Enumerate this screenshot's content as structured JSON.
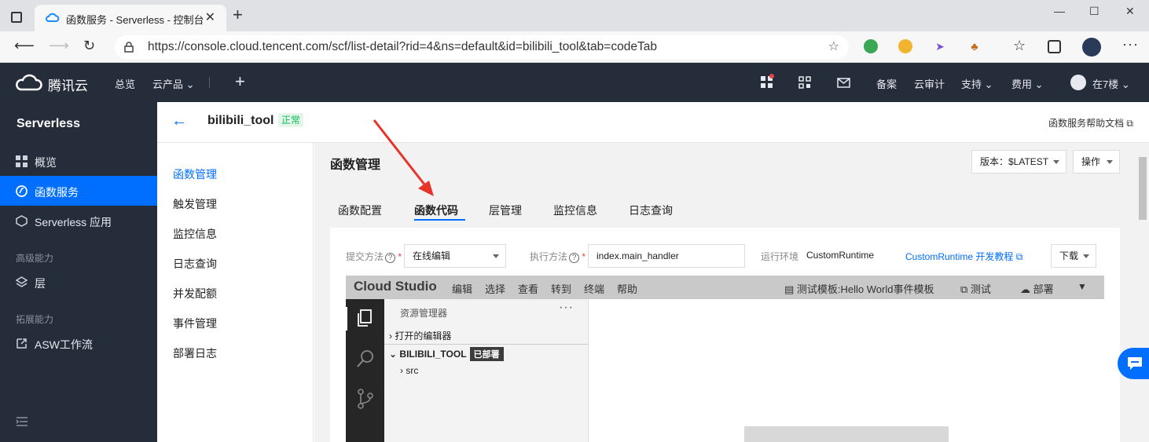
{
  "browser": {
    "tab_title": "函数服务 - Serverless - 控制台",
    "url": "https://console.cloud.tencent.com/scf/list-detail?rid=4&ns=default&id=bilibili_tool&tab=codeTab",
    "controls": {
      "minimize": "—",
      "maximize": "☐",
      "close": "✕"
    }
  },
  "topnav": {
    "brand": "腾讯云",
    "items": [
      "总览",
      "云产品 ⌄"
    ],
    "right_items": [
      "备案",
      "云审计",
      "支持 ⌄",
      "费用 ⌄"
    ],
    "user": "在7楼 ⌄"
  },
  "sidebar": {
    "title": "Serverless",
    "items": [
      {
        "label": "概览",
        "icon": "grid-icon"
      },
      {
        "label": "函数服务",
        "icon": "function-icon"
      },
      {
        "label": "Serverless 应用",
        "icon": "app-icon"
      }
    ],
    "group_advanced": "高级能力",
    "advanced_items": [
      {
        "label": "层",
        "icon": "layers-icon"
      }
    ],
    "group_ext": "拓展能力",
    "ext_items": [
      {
        "label": "ASW工作流",
        "icon": "workflow-icon"
      }
    ]
  },
  "header": {
    "function_name": "bilibili_tool",
    "status": "正常",
    "help_doc": "函数服务帮助文档"
  },
  "submenu": [
    "函数管理",
    "触发管理",
    "监控信息",
    "日志查询",
    "并发配额",
    "事件管理",
    "部署日志"
  ],
  "main": {
    "title": "函数管理",
    "version_select": "版本：$LATEST",
    "ops_select": "操作",
    "tabs": [
      "函数配置",
      "函数代码",
      "层管理",
      "监控信息",
      "日志查询"
    ],
    "active_tab": "函数代码"
  },
  "form": {
    "submit_label": "提交方法",
    "submit_value": "在线编辑",
    "handler_label": "执行方法",
    "handler_value": "index.main_handler",
    "runtime_label": "运行环境",
    "runtime_value": "CustomRuntime",
    "runtime_doc": "CustomRuntime 开发教程",
    "download": "下载"
  },
  "cloud_studio": {
    "logo": "Cloud Studio",
    "menu": [
      "编辑",
      "选择",
      "查看",
      "转到",
      "终端",
      "帮助"
    ],
    "test_template": "测试模板:Hello World事件模板",
    "test": "测试",
    "deploy": "部署",
    "explorer_title": "资源管理器",
    "open_editors": "打开的编辑器",
    "project": "BILIBILI_TOOL",
    "deployed_badge": "已部署",
    "folder": "src"
  },
  "colors": {
    "accent": "#006eff",
    "nav_bg": "#252d3b",
    "annotation_arrow": "#e8332a"
  }
}
